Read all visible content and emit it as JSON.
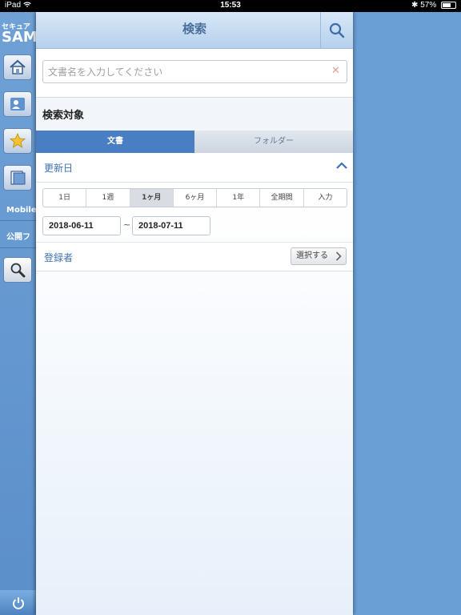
{
  "status_bar": {
    "device": "iPad",
    "time": "15:53",
    "battery": "57%"
  },
  "sidebar": {
    "brand_line1": "セキュア",
    "brand_line2": "SAMI",
    "items": [
      {
        "label": "Mobile"
      },
      {
        "label": "公開フ"
      }
    ]
  },
  "search_panel": {
    "title": "検索",
    "search_placeholder": "文書名を入力してください",
    "search_value": "",
    "target_label": "検索対象",
    "target_tabs": [
      {
        "label": "文書",
        "selected": true
      },
      {
        "label": "フォルダー",
        "selected": false
      }
    ],
    "update_date_label": "更新日",
    "periods": [
      {
        "label": "1日"
      },
      {
        "label": "1週"
      },
      {
        "label": "1ヶ月"
      },
      {
        "label": "6ヶ月"
      },
      {
        "label": "1年"
      },
      {
        "label": "全期間"
      },
      {
        "label": "入力"
      }
    ],
    "selected_period": "1ヶ月",
    "date_from": "2018-06-11",
    "date_separator": "~",
    "date_to": "2018-07-11",
    "registrant_label": "登録者",
    "select_button": "選択する"
  },
  "colors": {
    "accent": "#4a7ec3",
    "link": "#3d72b8",
    "background": "#6a9fd6"
  }
}
